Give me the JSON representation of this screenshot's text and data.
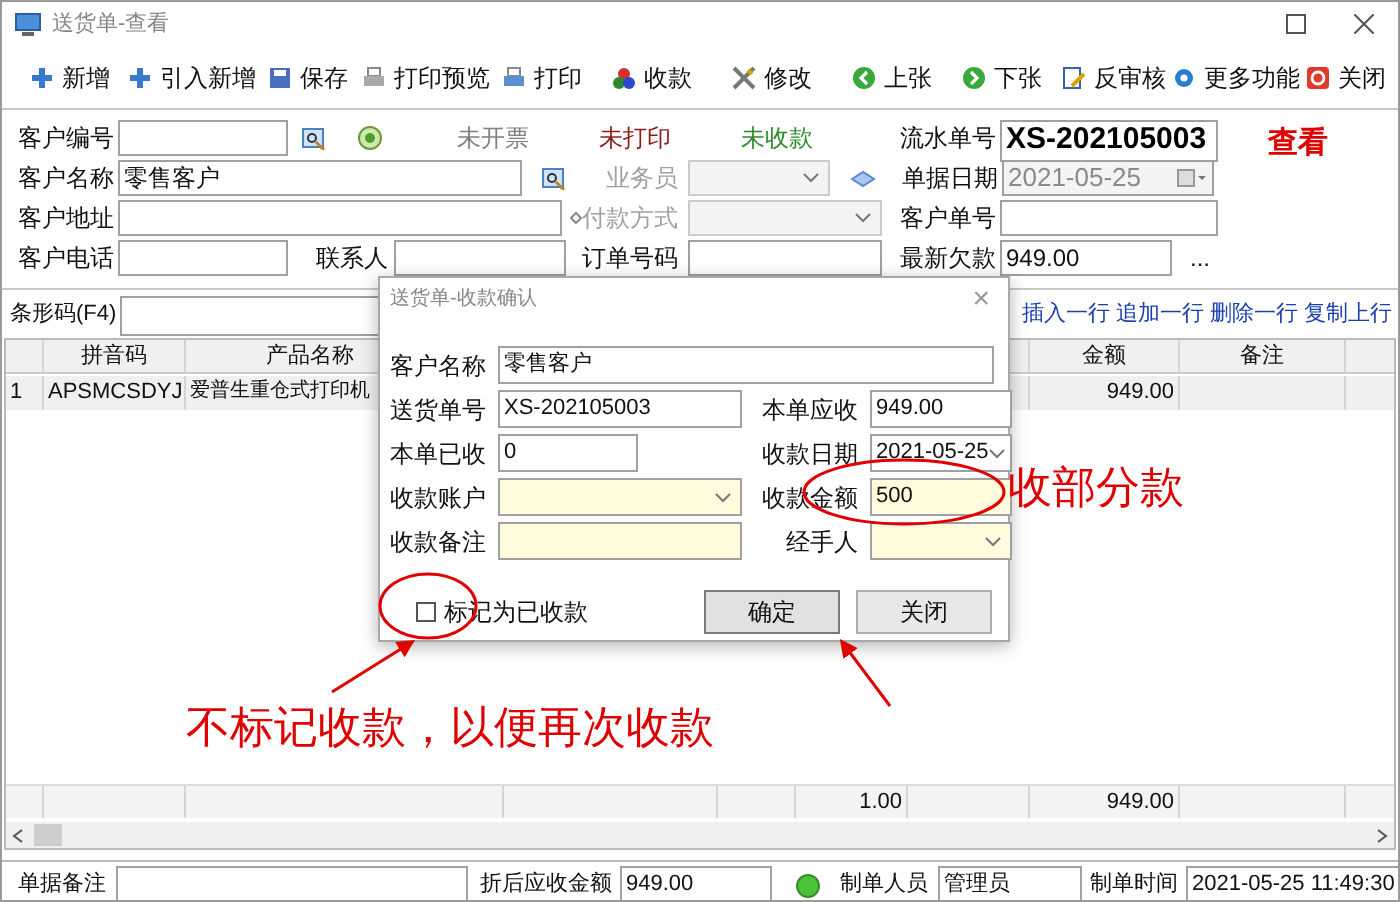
{
  "window": {
    "title": "送货单-查看"
  },
  "toolbar": [
    {
      "label": "新增"
    },
    {
      "label": "引入新增"
    },
    {
      "label": "保存"
    },
    {
      "label": "打印预览"
    },
    {
      "label": "打印"
    },
    {
      "label": "收款"
    },
    {
      "label": "修改"
    },
    {
      "label": "上张"
    },
    {
      "label": "下张"
    },
    {
      "label": "反审核"
    },
    {
      "label": "更多功能"
    },
    {
      "label": "关闭"
    }
  ],
  "statuses": [
    {
      "label": "未开票",
      "color": "#808080"
    },
    {
      "label": "未打印",
      "color": "#8b1a1a"
    },
    {
      "label": "未收款",
      "color": "#2e8b2e"
    }
  ],
  "mode": "查看",
  "form": {
    "customer_code": {
      "label": "客户编号"
    },
    "customer_name": {
      "label": "客户名称",
      "value": "零售客户"
    },
    "customer_address": {
      "label": "客户地址"
    },
    "customer_phone": {
      "label": "客户电话"
    },
    "contact": {
      "label": "联系人"
    },
    "salesperson": {
      "label": "业务员",
      "disabled": true
    },
    "payment_method": {
      "label": "付款方式",
      "disabled": true
    },
    "order_number": {
      "label": "订单号码"
    },
    "serial_number": {
      "label": "流水单号",
      "value": "XS-202105003"
    },
    "document_date": {
      "label": "单据日期",
      "value": "2021-05-25",
      "disabled": true
    },
    "customer_doc_number": {
      "label": "客户单号"
    },
    "latest_debt": {
      "label": "最新欠款",
      "value": "949.00"
    },
    "more": "..."
  },
  "barcode": {
    "label": "条形码(F4)"
  },
  "row_actions": [
    "插入一行",
    "追加一行",
    "删除一行",
    "复制上行"
  ],
  "table": {
    "header": {
      "pinyin_code": "拼音码",
      "product_name": "产品名称",
      "amount": "金额",
      "remarks": "备注"
    },
    "rows": [
      {
        "row_number": "1",
        "pinyin_code": "APSMCSDYJ",
        "product_name": "爱普生重仓式打印机",
        "amount": "949.00"
      }
    ],
    "totals": {
      "column_5": "1.00",
      "amount": "949.00"
    }
  },
  "footer": {
    "note": {
      "label": "单据备注"
    },
    "receivable": {
      "label": "折后应收金额",
      "value": "949.00"
    },
    "creator": {
      "label": "制单人员",
      "value": "管理员"
    },
    "created_time": {
      "label": "制单时间",
      "value": "2021-05-25 11:49:30"
    }
  },
  "dialog": {
    "title": "送货单-收款确认",
    "close": "×",
    "fields": [
      {
        "label": "客户名称",
        "value": "零售客户",
        "kind": "input",
        "highlighted": false
      },
      {
        "label": "送货单号",
        "value": "XS-202105003",
        "kind": "input",
        "highlighted": false
      },
      {
        "label": "本单应收",
        "value": "949.00",
        "kind": "input",
        "highlighted": false
      },
      {
        "label": "本单已收",
        "value": "0",
        "kind": "input",
        "highlighted": false
      },
      {
        "label": "收款日期",
        "value": "2021-05-25",
        "kind": "select",
        "highlighted": false
      },
      {
        "label": "收款账户",
        "kind": "select",
        "highlighted": true
      },
      {
        "label": "收款金额",
        "value": "500",
        "kind": "input",
        "highlighted": true
      },
      {
        "label": "收款备注",
        "kind": "input",
        "highlighted": true
      },
      {
        "label": "经手人",
        "kind": "select",
        "highlighted": true
      }
    ],
    "checkbox": {
      "label": "标记为已收款",
      "checked": false
    },
    "buttons": [
      {
        "label": "确定",
        "default": true
      },
      {
        "label": "关闭",
        "default": false
      }
    ]
  },
  "annotations": [
    {
      "text": "收部分款"
    },
    {
      "text": "不标记收款，以便再次收款"
    }
  ]
}
